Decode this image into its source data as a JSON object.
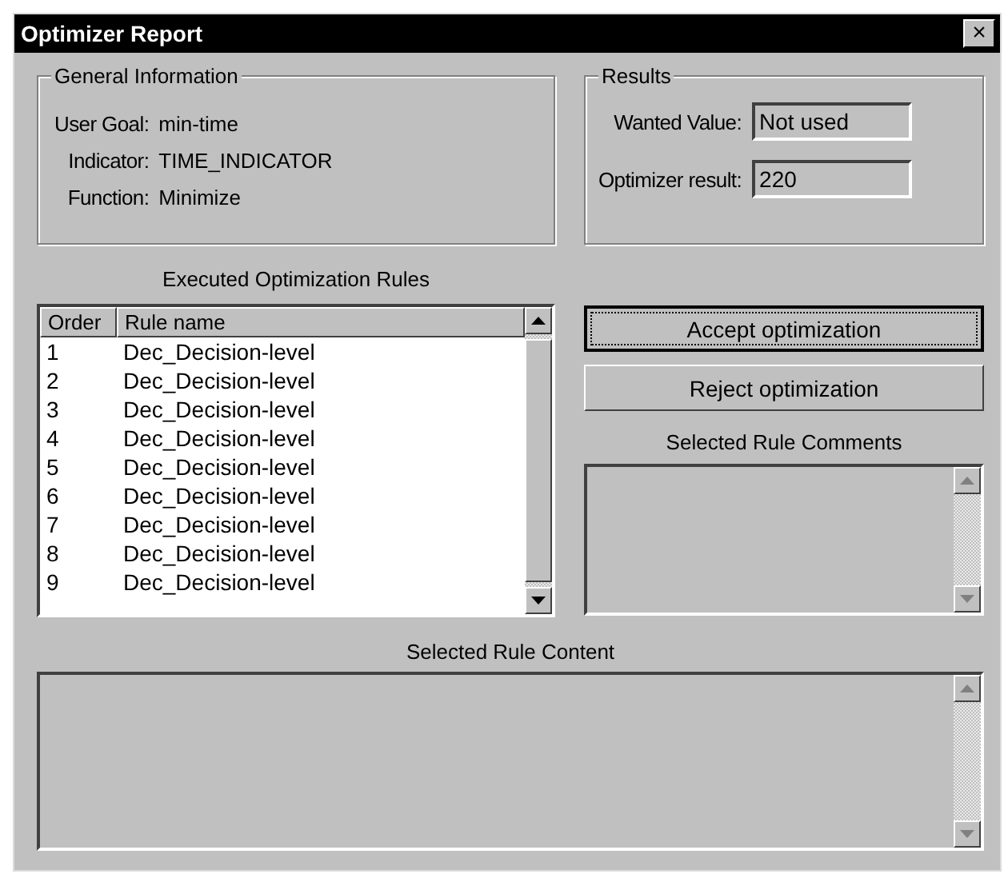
{
  "window": {
    "title": "Optimizer Report",
    "close": "×"
  },
  "general_information": {
    "title": "General Information",
    "fields": [
      {
        "label": "User Goal:",
        "value": "min-time"
      },
      {
        "label": "Indicator:",
        "value": "TIME_INDICATOR"
      },
      {
        "label": "Function:",
        "value": "Minimize"
      }
    ]
  },
  "results": {
    "title": "Results",
    "fields": [
      {
        "label": "Wanted Value:",
        "value": "Not used"
      },
      {
        "label": "Optimizer result:",
        "value": "220"
      }
    ]
  },
  "rules": {
    "title": "Executed Optimization Rules",
    "columns": [
      "Order",
      "Rule name"
    ],
    "rows": [
      [
        "1",
        "Dec_Decision-level"
      ],
      [
        "2",
        "Dec_Decision-level"
      ],
      [
        "3",
        "Dec_Decision-level"
      ],
      [
        "4",
        "Dec_Decision-level"
      ],
      [
        "5",
        "Dec_Decision-level"
      ],
      [
        "6",
        "Dec_Decision-level"
      ],
      [
        "7",
        "Dec_Decision-level"
      ],
      [
        "8",
        "Dec_Decision-level"
      ],
      [
        "9",
        "Dec_Decision-level"
      ]
    ]
  },
  "buttons": [
    {
      "label": "Accept optimization",
      "focused": true
    },
    {
      "label": "Reject optimization",
      "focused": false
    }
  ],
  "comments": {
    "title": "Selected Rule Comments"
  },
  "content": {
    "title": "Selected Rule Content"
  }
}
